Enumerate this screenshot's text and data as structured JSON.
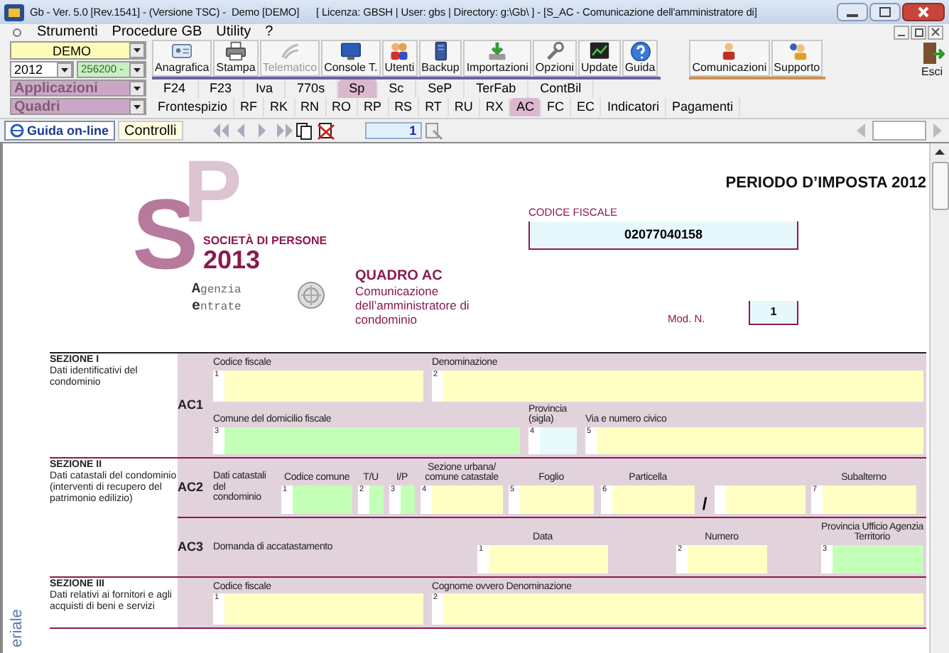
{
  "window": {
    "title": "Gb - Ver. 5.0 [Rev.1541] - (Versione TSC) -  Demo [DEMO]      [ Licenza: GBSH | User: gbs | Directory: g:\\Gb\\ ] - [S_AC - Comunicazione dell'amministratore di]"
  },
  "menu": [
    {
      "label": "Strumenti"
    },
    {
      "label": "Procedure GB"
    },
    {
      "label": "Utility"
    },
    {
      "label": "?"
    }
  ],
  "selectors": {
    "company": "DEMO",
    "year": "2012",
    "code": "256200 -",
    "applications": "Applicazioni",
    "frames": "Quadri"
  },
  "toolbar": [
    {
      "label": "Anagrafica",
      "disabled": false
    },
    {
      "label": "Stampa",
      "disabled": false
    },
    {
      "label": "Telematico",
      "disabled": true
    },
    {
      "label": "Console T.",
      "disabled": false
    },
    {
      "label": "Utenti",
      "disabled": false
    },
    {
      "label": "Backup",
      "disabled": false
    },
    {
      "label": "Importazioni",
      "disabled": false
    },
    {
      "label": "Opzioni",
      "disabled": false
    },
    {
      "label": "Update",
      "disabled": false
    },
    {
      "label": "Guida",
      "disabled": false
    }
  ],
  "toolbar_right": [
    {
      "label": "Comunicazioni"
    },
    {
      "label": "Supporto"
    }
  ],
  "exit": {
    "label": "Esci"
  },
  "app_tabs": [
    {
      "label": "F24",
      "selected": false
    },
    {
      "label": "F23",
      "selected": false
    },
    {
      "label": "Iva",
      "selected": false
    },
    {
      "label": "770s",
      "selected": false
    },
    {
      "label": "Sp",
      "selected": true
    },
    {
      "label": "Sc",
      "selected": false
    },
    {
      "label": "SeP",
      "selected": false
    },
    {
      "label": "TerFab",
      "selected": false
    },
    {
      "label": "ContBil",
      "selected": false
    }
  ],
  "frame_tabs": [
    {
      "label": "Frontespizio",
      "selected": false
    },
    {
      "label": "RF",
      "selected": false
    },
    {
      "label": "RK",
      "selected": false
    },
    {
      "label": "RN",
      "selected": false
    },
    {
      "label": "RO",
      "selected": false
    },
    {
      "label": "RP",
      "selected": false
    },
    {
      "label": "RS",
      "selected": false
    },
    {
      "label": "RT",
      "selected": false
    },
    {
      "label": "RU",
      "selected": false
    },
    {
      "label": "RX",
      "selected": false
    },
    {
      "label": "AC",
      "selected": true
    },
    {
      "label": "FC",
      "selected": false
    },
    {
      "label": "EC",
      "selected": false
    },
    {
      "label": "Indicatori",
      "selected": false
    },
    {
      "label": "Pagamenti",
      "selected": false
    }
  ],
  "nav": {
    "help": "Guida on-line",
    "checks": "Controlli",
    "page": "1"
  },
  "form": {
    "logo": {
      "letters": [
        "S",
        "P"
      ],
      "line1": "SOCIETÀ DI PERSONE",
      "line2": "2013",
      "agency": [
        {
          "initial": "A",
          "rest": "genzia"
        },
        {
          "initial": "e",
          "rest": "ntrate"
        }
      ]
    },
    "period": "PERIODO D’IMPOSTA 2012",
    "tax_code_label": "CODICE FISCALE",
    "tax_code": "02077040158",
    "frame_title": "QUADRO AC",
    "frame_subtitle": "Comunicazione dell’amministratore di condominio",
    "module_label": "Mod. N.",
    "module": "1",
    "side_text": "eriale",
    "sections": [
      {
        "title": "SEZIONE I",
        "description": "Dati identificativi del condominio",
        "rows": [
          {
            "code": "AC1",
            "lines": [
              [
                {
                  "kind": "field",
                  "label": "Codice fiscale",
                  "number": "1",
                  "color": "#ffffc4"
                },
                {
                  "kind": "field",
                  "label": "Denominazione",
                  "number": "2",
                  "color": "#ffffc4"
                }
              ],
              [
                {
                  "kind": "field",
                  "label": "Comune del domicilio fiscale",
                  "number": "3",
                  "color": "#c4ffb8"
                },
                {
                  "kind": "field",
                  "label": "Provincia (sigla)",
                  "number": "4",
                  "color": "#e8fafc"
                },
                {
                  "kind": "field",
                  "label": "Via e numero civico",
                  "number": "5",
                  "color": "#ffffc4"
                }
              ]
            ]
          }
        ]
      },
      {
        "title": "SEZIONE II",
        "description": "Dati catastali del condominio (interventi di recupero del patrimonio edilizio)",
        "rows": [
          {
            "code": "AC2",
            "lines": [
              [
                {
                  "kind": "note",
                  "label": "Dati catastali del condominio"
                },
                {
                  "kind": "field",
                  "label": "Codice comune",
                  "number": "1",
                  "color": "#c4ffb8"
                },
                {
                  "kind": "field",
                  "label": "T/U",
                  "number": "2",
                  "color": "#c4ffb8"
                },
                {
                  "kind": "field",
                  "label": "I/P",
                  "number": "3",
                  "color": "#c4ffb8"
                },
                {
                  "kind": "field",
                  "label": "Sezione urbana/ comune catastale",
                  "number": "4",
                  "color": "#ffffc4"
                },
                {
                  "kind": "field",
                  "label": "Foglio",
                  "number": "5",
                  "color": "#ffffc4"
                },
                {
                  "kind": "field",
                  "label": "Particella",
                  "number": "6",
                  "color": "#ffffc4"
                },
                {
                  "kind": "separator",
                  "label": "/"
                },
                {
                  "kind": "field",
                  "color": "#ffffc4"
                },
                {
                  "kind": "field",
                  "label": "Subalterno",
                  "number": "7",
                  "color": "#ffffc4"
                }
              ]
            ]
          },
          {
            "code": "AC3",
            "lines": [
              [
                {
                  "kind": "note",
                  "label": "Domanda di accatastamento"
                },
                {
                  "kind": "field",
                  "label": "Data",
                  "number": "1",
                  "color": "#ffffc4"
                },
                {
                  "kind": "field",
                  "label": "Numero",
                  "number": "2",
                  "color": "#ffffc4"
                },
                {
                  "kind": "field",
                  "label": "Provincia Ufficio Agenzia Territorio",
                  "number": "3",
                  "color": "#c4ffb8"
                }
              ]
            ]
          }
        ]
      },
      {
        "title": "SEZIONE III",
        "description": "Dati relativi ai fornitori e agli acquisti di beni e servizi",
        "rows": [
          {
            "lines": [
              [
                {
                  "kind": "field",
                  "label": "Codice fiscale",
                  "number": "1",
                  "color": "#ffffc4"
                },
                {
                  "kind": "field",
                  "label": "Cognome ovvero Denominazione",
                  "number": "2",
                  "color": "#ffffc4"
                }
              ]
            ]
          }
        ]
      }
    ]
  }
}
